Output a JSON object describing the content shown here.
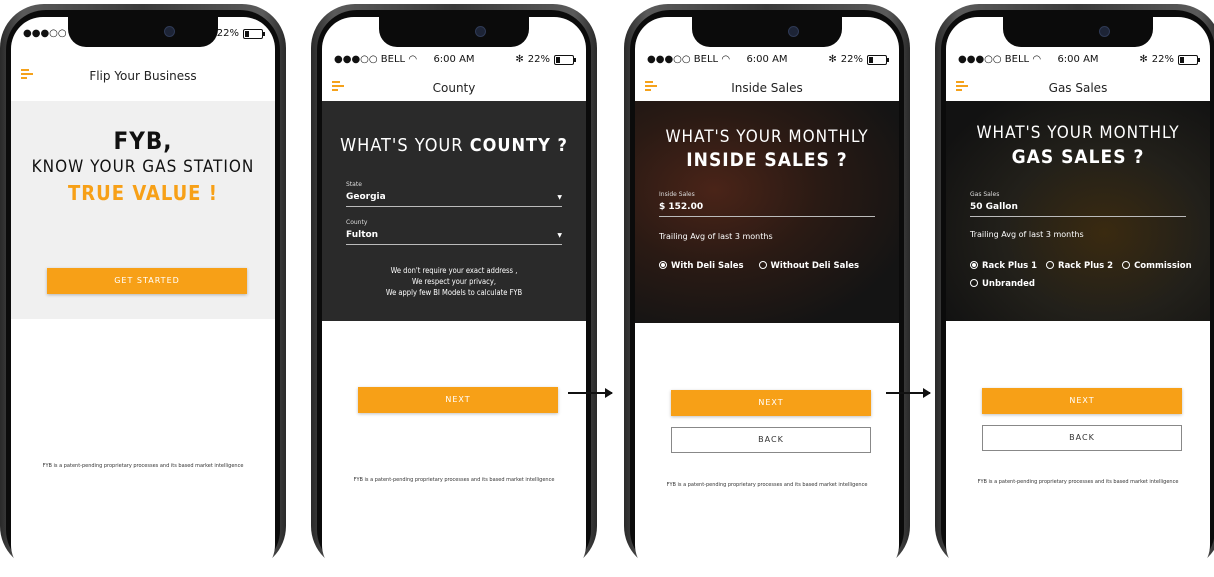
{
  "status": {
    "carrier": "●●●○○ BELL ",
    "wifi": "wifi-icon",
    "time": "6:00 AM",
    "battery": "22%",
    "bluetooth": "✻"
  },
  "screen1": {
    "header_title": "Flip Your Business",
    "hero_line1": "FYB,",
    "hero_line2": "KNOW YOUR GAS STATION",
    "hero_line3": "TRUE VALUE !",
    "button": "GET STARTED",
    "footer": "FYB is a patent-pending proprietary processes and its based market intelligence"
  },
  "screen2": {
    "header_title": "County",
    "heading_a": "WHAT'S YOUR ",
    "heading_b": "COUNTY ?",
    "state_label": "State",
    "state_value": "Georgia",
    "county_label": "County",
    "county_value": "Fulton",
    "note1": "We don't require your exact address ,",
    "note2": "We respect your privacy,",
    "note3": "We apply few BI Models to calculate FYB",
    "button": "NEXT",
    "footer": "FYB is a patent-pending proprietary processes and its based market intelligence"
  },
  "screen3": {
    "header_title": "Inside Sales",
    "heading_a": "WHAT'S YOUR MONTHLY",
    "heading_b": "INSIDE SALES ?",
    "field_label": "Inside Sales",
    "field_value": "$ 152.00",
    "trailing": "Trailing Avg of last 3 months",
    "radio1": "With Deli Sales",
    "radio2": "Without Deli Sales",
    "button_next": "NEXT",
    "button_back": "BACK",
    "footer": "FYB is a patent-pending proprietary processes and its based market intelligence"
  },
  "screen4": {
    "header_title": "Gas Sales",
    "heading_a": "WHAT'S YOUR MONTHLY",
    "heading_b": "GAS SALES ?",
    "field_label": "Gas Sales",
    "field_value": "50 Gallon",
    "trailing": "Trailing Avg of last 3 months",
    "radio1": "Rack Plus 1",
    "radio2": "Rack Plus 2",
    "radio3": "Commission",
    "radio4": "Unbranded",
    "button_next": "NEXT",
    "button_back": "BACK",
    "footer": "FYB is a patent-pending proprietary processes and its based market intelligence"
  },
  "colors": {
    "accent": "#f7a017",
    "grey_hero": "#f0f0f0",
    "dark_hero": "#2a2a2a"
  }
}
